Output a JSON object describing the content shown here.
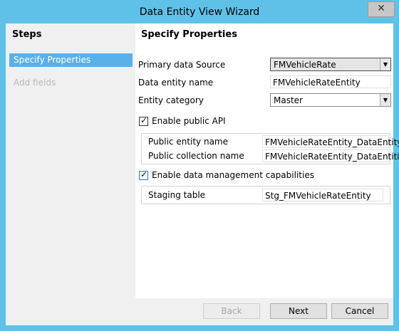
{
  "window": {
    "title": "Data Entity View Wizard",
    "close_glyph": "✕"
  },
  "sidebar": {
    "heading": "Steps",
    "steps": [
      {
        "label": "Specify Properties"
      },
      {
        "label": "Add fields"
      }
    ]
  },
  "main": {
    "heading": "Specify Properties",
    "primary_data_source": {
      "label": "Primary data Source",
      "value": "FMVehicleRate"
    },
    "data_entity_name": {
      "label": "Data entity name",
      "value": "FMVehicleRateEntity"
    },
    "entity_category": {
      "label": "Entity category",
      "value": "Master"
    },
    "enable_public_api": {
      "label": "Enable public API",
      "checked": true
    },
    "public_entity_name": {
      "label": "Public entity name",
      "value": "FMVehicleRateEntity_DataEntity"
    },
    "public_collection_name": {
      "label": "Public collection name",
      "value": "FMVehicleRateEntity_DataEntities"
    },
    "enable_data_management": {
      "label": "Enable data management capabilities",
      "checked": true
    },
    "staging_table": {
      "label": "Staging table",
      "value": "Stg_FMVehicleRateEntity"
    }
  },
  "footer": {
    "back_label": "Back",
    "next_label": "Next",
    "cancel_label": "Cancel"
  },
  "icons": {
    "check": "✓",
    "dropdown": "▼"
  },
  "colors": {
    "title_bar": "#5fc1e8",
    "selected_step": "#5ab0e8"
  }
}
